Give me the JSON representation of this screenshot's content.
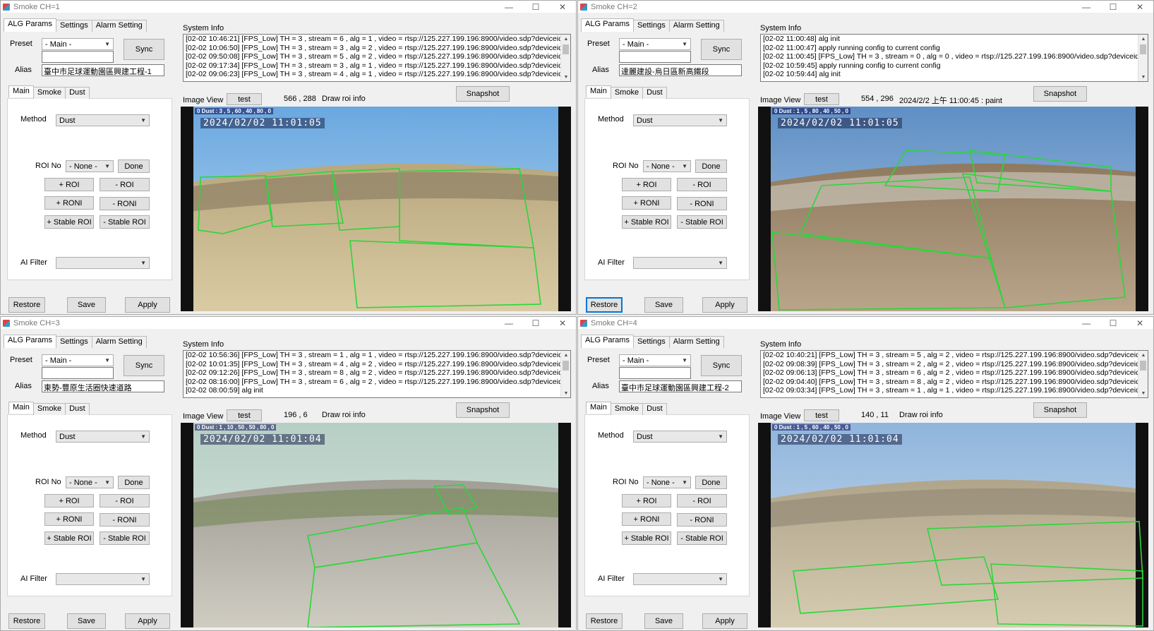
{
  "common": {
    "tabs": [
      "ALG Params",
      "Settings",
      "Alarm Setting"
    ],
    "preset_label": "Preset",
    "preset_value": "- Main -",
    "sync": "Sync",
    "alias_label": "Alias",
    "subtabs": [
      "Main",
      "Smoke",
      "Dust"
    ],
    "method_label": "Method",
    "method_value": "Dust",
    "roi_no_label": "ROI No",
    "roi_value": "- None -",
    "done": "Done",
    "add_roi": "+ ROI",
    "rem_roi": "- ROI",
    "add_roni": "+ RONI",
    "rem_roni": "- RONI",
    "add_stable": "+ Stable ROI",
    "rem_stable": "- Stable ROI",
    "ai_filter_label": "AI Filter",
    "restore": "Restore",
    "save": "Save",
    "apply": "Apply",
    "system_info": "System Info",
    "image_view": "Image View",
    "test": "test",
    "snapshot": "Snapshot",
    "minimize": "—",
    "maximize": "☐",
    "close": "✕"
  },
  "windows": [
    {
      "title": "Smoke CH=1",
      "alias": "臺中市足球運動園區興建工程-1",
      "coords": "566 , 288",
      "status": "Draw roi info",
      "overlay": "0 Dust : 3 , 5 , 60 , 40 , 80 , 0",
      "timestamp": "2024/02/02 11:01:05",
      "log": [
        "[02-02 10:46:21] [FPS_Low] TH = 3 , stream = 6 , alg = 1 , video = rtsp://125.227.199.196:8900/video.sdp?deviceid",
        "[02-02 10:06:50] [FPS_Low] TH = 3 , stream = 3 , alg = 2 , video = rtsp://125.227.199.196:8900/video.sdp?deviceid",
        "[02-02 09:50:08] [FPS_Low] TH = 3 , stream = 5 , alg = 2 , video = rtsp://125.227.199.196:8900/video.sdp?deviceid",
        "[02-02 09:17:34] [FPS_Low] TH = 3 , stream = 3 , alg = 1 , video = rtsp://125.227.199.196:8900/video.sdp?deviceid",
        "[02-02 09:06:23] [FPS_Low] TH = 3 , stream = 4 , alg = 1 , video = rtsp://125.227.199.196:8900/video.sdp?deviceid"
      ]
    },
    {
      "title": "Smoke CH=2",
      "alias": "達麗建設-烏日區新高鐵段",
      "coords": "554 , 296",
      "status": "2024/2/2 上午 11:00:45 : paint",
      "overlay": "0 Dust : 1 , 5 , 80 , 40 , 50 , 0",
      "timestamp": "2024/02/02 11:01:05",
      "log": [
        "[02-02 11:00:48] alg init",
        "[02-02 11:00:47] apply running config to current config",
        "[02-02 11:00:45] [FPS_Low] TH = 3 , stream = 0 , alg = 0 , video = rtsp://125.227.199.196:8900/video.sdp?deviceid",
        "[02-02 10:59:45] apply running config to current config",
        "[02-02 10:59:44] alg init"
      ]
    },
    {
      "title": "Smoke CH=3",
      "alias": "東勢-豐原生活圈快速道路",
      "coords": "196 , 6",
      "status": "Draw roi info",
      "overlay": "0 Dust : 1 , 10 , 50 , 50 , 80 , 0",
      "timestamp": "2024/02/02 11:01:04",
      "log": [
        "[02-02 10:56:36] [FPS_Low] TH = 3 , stream = 1 , alg = 1 , video = rtsp://125.227.199.196:8900/video.sdp?deviceid",
        "[02-02 10:01:35] [FPS_Low] TH = 3 , stream = 4 , alg = 2 , video = rtsp://125.227.199.196:8900/video.sdp?deviceid",
        "[02-02 09:12:26] [FPS_Low] TH = 3 , stream = 8 , alg = 2 , video = rtsp://125.227.199.196:8900/video.sdp?deviceid",
        "[02-02 08:16:00] [FPS_Low] TH = 3 , stream = 6 , alg = 2 , video = rtsp://125.227.199.196:8900/video.sdp?deviceid",
        "[02-02 08:00:59] alg init"
      ]
    },
    {
      "title": "Smoke CH=4",
      "alias": "臺中市足球運動園區興建工程-2",
      "coords": "140 , 11",
      "status": "Draw roi info",
      "overlay": "0 Dust : 1 , 5 , 60 , 40 , 50 , 0",
      "timestamp": "2024/02/02 11:01:04",
      "log": [
        "[02-02 10:40:21] [FPS_Low] TH = 3 , stream = 5 , alg = 2 , video = rtsp://125.227.199.196:8900/video.sdp?deviceid",
        "[02-02 09:08:39] [FPS_Low] TH = 3 , stream = 2 , alg = 2 , video = rtsp://125.227.199.196:8900/video.sdp?deviceid",
        "[02-02 09:06:13] [FPS_Low] TH = 3 , stream = 6 , alg = 2 , video = rtsp://125.227.199.196:8900/video.sdp?deviceid",
        "[02-02 09:04:40] [FPS_Low] TH = 3 , stream = 8 , alg = 2 , video = rtsp://125.227.199.196:8900/video.sdp?deviceid",
        "[02-02 09:03:34] [FPS_Low] TH = 3 , stream = 1 , alg = 1 , video = rtsp://125.227.199.196:8900/video.sdp?deviceid"
      ]
    }
  ]
}
